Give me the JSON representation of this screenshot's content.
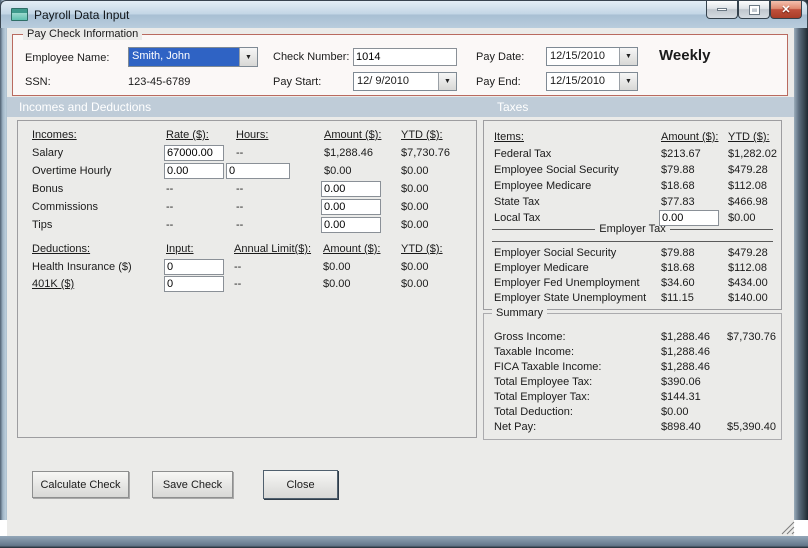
{
  "window": {
    "title": "Payroll Data Input"
  },
  "colors": {
    "accent_red": "#B96A5F",
    "section_bar": "#BFCCD8",
    "selection_blue": "#2F63C4",
    "close_button_red": "#C0503C",
    "titlebar_blue": "#C3D6E5"
  },
  "paycheck": {
    "legend": "Pay Check Information",
    "employee_name_label": "Employee Name:",
    "employee_name_value": "Smith, John",
    "ssn_label": "SSN:",
    "ssn_value": "123-45-6789",
    "check_number_label": "Check Number:",
    "check_number_value": "1014",
    "pay_start_label": "Pay Start:",
    "pay_start_value": "12/ 9/2010",
    "pay_date_label": "Pay Date:",
    "pay_date_value": "12/15/2010",
    "pay_end_label": "Pay End:",
    "pay_end_value": "12/15/2010",
    "frequency": "Weekly"
  },
  "section_headers": {
    "left": "Incomes and Deductions",
    "right": "Taxes"
  },
  "incomes": {
    "headers": [
      "Incomes:",
      "Rate ($):",
      "Hours:",
      "Amount ($):",
      "YTD ($):"
    ],
    "rows": [
      {
        "name": "salary",
        "cells": [
          {
            "t": "Salary"
          },
          {
            "t": "67000.00",
            "input": true
          },
          {
            "t": "--"
          },
          {
            "t": "$1,288.46"
          },
          {
            "t": "$7,730.76"
          }
        ]
      },
      {
        "name": "overtime-hourly",
        "cells": [
          {
            "t": "Overtime Hourly"
          },
          {
            "t": "0.00",
            "input": true
          },
          {
            "t": "0",
            "input": true
          },
          {
            "t": "$0.00"
          },
          {
            "t": "$0.00"
          }
        ]
      },
      {
        "name": "bonus",
        "cells": [
          {
            "t": "Bonus"
          },
          {
            "t": "--"
          },
          {
            "t": "--"
          },
          {
            "t": "0.00",
            "input": true
          },
          {
            "t": "$0.00"
          }
        ]
      },
      {
        "name": "commissions",
        "cells": [
          {
            "t": "Commissions"
          },
          {
            "t": "--"
          },
          {
            "t": "--"
          },
          {
            "t": "0.00",
            "input": true
          },
          {
            "t": "$0.00"
          }
        ]
      },
      {
        "name": "tips",
        "cells": [
          {
            "t": "Tips"
          },
          {
            "t": "--"
          },
          {
            "t": "--"
          },
          {
            "t": "0.00",
            "input": true
          },
          {
            "t": "$0.00"
          }
        ]
      }
    ]
  },
  "deductions": {
    "headers": [
      "Deductions:",
      "Input:",
      "Annual Limit($):",
      "Amount ($):",
      "YTD ($):"
    ],
    "rows": [
      {
        "name": "health-insurance",
        "cells": [
          {
            "t": "Health Insurance  ($)"
          },
          {
            "t": "0",
            "input": true
          },
          {
            "t": "--"
          },
          {
            "t": "$0.00"
          },
          {
            "t": "$0.00"
          }
        ]
      },
      {
        "name": "401k",
        "cells": [
          {
            "t": "401K  ($)",
            "u": true
          },
          {
            "t": "0",
            "input": true
          },
          {
            "t": "--"
          },
          {
            "t": "$0.00"
          },
          {
            "t": "$0.00"
          }
        ]
      }
    ]
  },
  "taxes": {
    "headers": [
      "Items:",
      "Amount ($):",
      "YTD ($):"
    ],
    "rows": [
      {
        "name": "federal-tax",
        "cells": [
          {
            "t": "Federal Tax"
          },
          {
            "t": "$213.67"
          },
          {
            "t": "$1,282.02"
          }
        ]
      },
      {
        "name": "employee-social-security",
        "cells": [
          {
            "t": "Employee Social Security"
          },
          {
            "t": "$79.88"
          },
          {
            "t": "$479.28"
          }
        ]
      },
      {
        "name": "employee-medicare",
        "cells": [
          {
            "t": "Employee Medicare"
          },
          {
            "t": "$18.68"
          },
          {
            "t": "$112.08"
          }
        ]
      },
      {
        "name": "state-tax",
        "cells": [
          {
            "t": "State Tax"
          },
          {
            "t": "$77.83"
          },
          {
            "t": "$466.98"
          }
        ]
      },
      {
        "name": "local-tax",
        "cells": [
          {
            "t": "Local Tax"
          },
          {
            "t": "0.00",
            "input": true
          },
          {
            "t": "$0.00"
          }
        ]
      }
    ],
    "employer_header": "Employer Tax",
    "employer_rows": [
      {
        "name": "employer-social-security",
        "cells": [
          {
            "t": "Employer Social Security"
          },
          {
            "t": "$79.88"
          },
          {
            "t": "$479.28"
          }
        ]
      },
      {
        "name": "employer-medicare",
        "cells": [
          {
            "t": "Employer Medicare"
          },
          {
            "t": "$18.68"
          },
          {
            "t": "$112.08"
          }
        ]
      },
      {
        "name": "employer-fed-unemployment",
        "cells": [
          {
            "t": "Employer Fed Unemployment"
          },
          {
            "t": "$34.60"
          },
          {
            "t": "$434.00"
          }
        ]
      },
      {
        "name": "employer-state-unemployment",
        "cells": [
          {
            "t": "Employer State Unemployment"
          },
          {
            "t": "$11.15"
          },
          {
            "t": "$140.00"
          }
        ]
      }
    ]
  },
  "summary": {
    "legend": "Summary",
    "rows": [
      {
        "name": "gross-income",
        "label": "Gross Income:",
        "amount": "$1,288.46",
        "ytd": "$7,730.76"
      },
      {
        "name": "taxable-income",
        "label": "Taxable Income:",
        "amount": "$1,288.46",
        "ytd": ""
      },
      {
        "name": "fica-taxable-income",
        "label": "FICA Taxable Income:",
        "amount": "$1,288.46",
        "ytd": ""
      },
      {
        "name": "total-employee-tax",
        "label": "Total Employee Tax:",
        "amount": "$390.06",
        "ytd": ""
      },
      {
        "name": "total-employer-tax",
        "label": "Total Employer Tax:",
        "amount": "$144.31",
        "ytd": ""
      },
      {
        "name": "total-deduction",
        "label": "Total Deduction:",
        "amount": "$0.00",
        "ytd": ""
      },
      {
        "name": "net-pay",
        "label": "Net Pay:",
        "amount": "$898.40",
        "ytd": "$5,390.40"
      }
    ]
  },
  "buttons": {
    "calculate": "Calculate Check",
    "save": "Save Check",
    "close": "Close"
  }
}
